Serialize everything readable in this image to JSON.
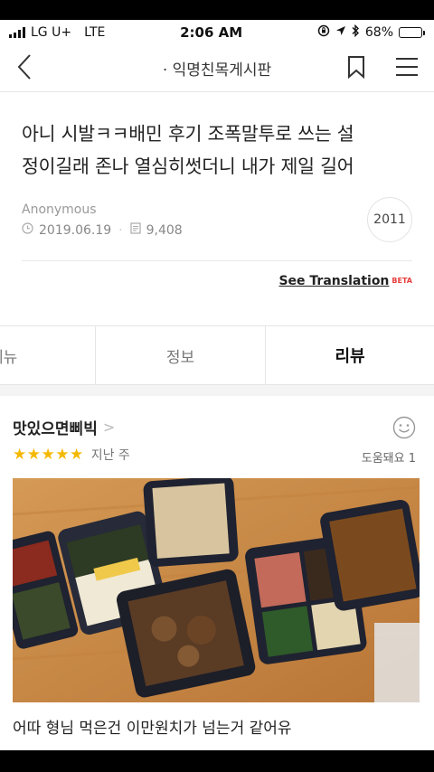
{
  "status_bar": {
    "carrier": "LG U+",
    "network": "LTE",
    "time": "2:06 AM",
    "battery": "68%",
    "battery_level": 0.68
  },
  "nav": {
    "title": "· 익명친목게시판",
    "back_icon": "chevron-left-icon",
    "bookmark_icon": "bookmark-icon",
    "menu_icon": "hamburger-icon"
  },
  "post": {
    "title_line1": "아니 시발ㅋㅋ배민 후기 조폭말투로 쓰는 설",
    "title_line2": "정이길래 존나 열심히썻더니 내가 제일 길어",
    "author": "Anonymous",
    "date": "2019.06.19",
    "views": "9,408",
    "badge": "2011",
    "translate_link": "See Translation",
    "translate_beta": "BETA"
  },
  "tabs": [
    {
      "label": "메뉴"
    },
    {
      "label": "정보"
    },
    {
      "label": "리뷰"
    }
  ],
  "review": {
    "name": "맛있으면삐빅",
    "chevron": ">",
    "stars": "★★★★★",
    "rating": 5,
    "time_ago": "지난 주",
    "helpful_label": "도움돼요 1",
    "caption": "어따 형님 먹은건 이만원치가 넘는거 같어유"
  },
  "colors": {
    "star": "#f5b800",
    "beta": "#e63c3c",
    "accent": "#222222"
  }
}
